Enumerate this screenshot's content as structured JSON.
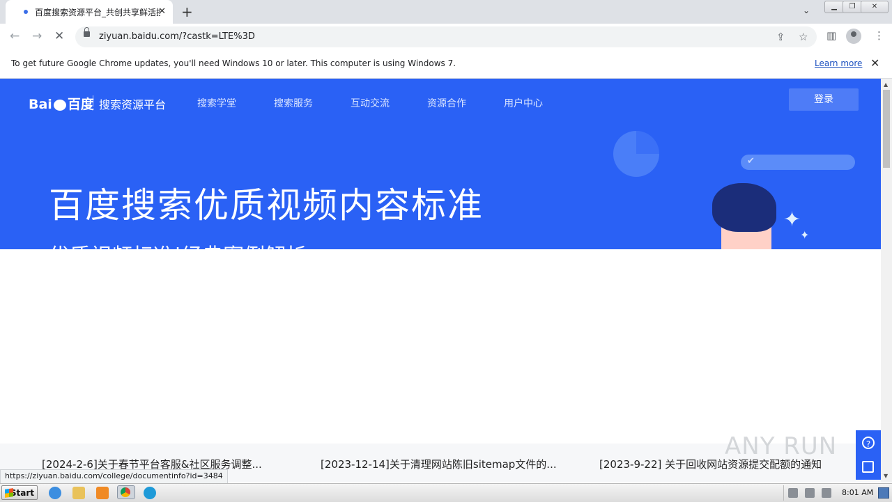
{
  "browser": {
    "tab_title": "百度搜索资源平台_共创共享鲜活搜索",
    "tab_close": "✕",
    "new_tab": "+",
    "url": "ziyuan.baidu.com/?castk=LTE%3D",
    "status_url": "https://ziyuan.baidu.com/college/documentinfo?id=3484"
  },
  "infobar": {
    "message": "To get future Google Chrome updates, you'll need Windows 10 or later. This computer is using Windows 7.",
    "learn_more": "Learn more",
    "close": "✕"
  },
  "site": {
    "logo_text": "Bai",
    "logo_text2": "百度",
    "logo_subtitle": "搜索资源平台",
    "nav": [
      "搜索学堂",
      "搜索服务",
      "互动交流",
      "资源合作",
      "用户中心"
    ],
    "login": "登录",
    "hero_title": "百度搜索优质视频内容标准",
    "hero_subtitle": "优质视频标准|经典案例解析"
  },
  "news": [
    "[2024-2-6]关于春节平台客服&社区服务调整...",
    "[2023-12-14]关于清理网站陈旧sitemap文件的...",
    "[2023-9-22] 关于回收网站资源提交配额的通知"
  ],
  "watermark": "ANY RUN",
  "taskbar": {
    "start": "Start",
    "time": "8:01 AM"
  },
  "colors": {
    "brand_blue": "#2a61f5",
    "login_button": "#4e7cf7"
  }
}
